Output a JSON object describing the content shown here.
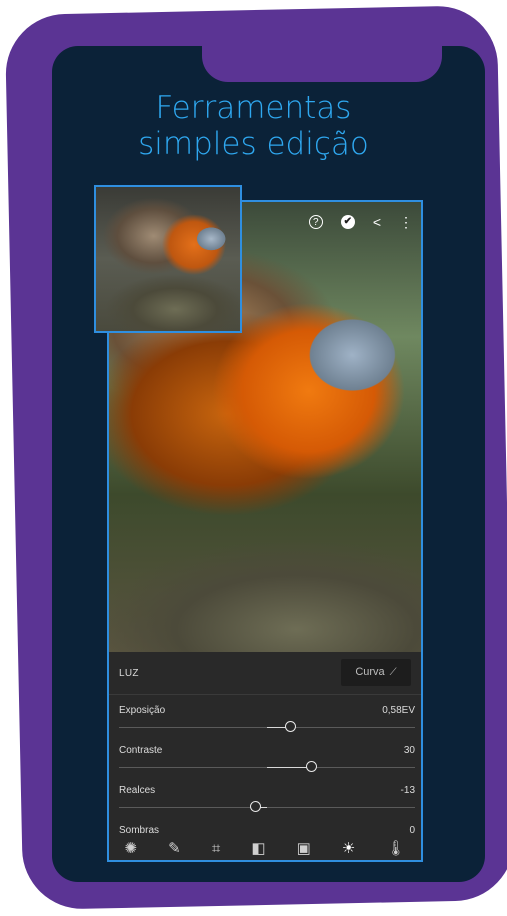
{
  "headline": {
    "line1": "Ferramentas",
    "line2": "simples edição"
  },
  "editor": {
    "top_icons": [
      {
        "name": "help-icon",
        "glyph": "?"
      },
      {
        "name": "check-icon",
        "glyph": "✔"
      },
      {
        "name": "share-icon",
        "glyph": "<"
      },
      {
        "name": "more-icon",
        "glyph": "⋮"
      }
    ],
    "panel": {
      "title": "LUZ",
      "curve_button": "Curva",
      "curve_icon_glyph": "⟋",
      "sliders": [
        {
          "label": "Exposição",
          "value": "0,58EV",
          "position": 0.58
        },
        {
          "label": "Contraste",
          "value": "30",
          "position": 0.65
        },
        {
          "label": "Realces",
          "value": "-13",
          "position": 0.46
        },
        {
          "label": "Sombras",
          "value": "0",
          "position": 0.5
        }
      ]
    },
    "toolbar": [
      {
        "name": "presets-icon",
        "glyph": "✺"
      },
      {
        "name": "healing-brush-icon",
        "glyph": "✎"
      },
      {
        "name": "crop-icon",
        "glyph": "⌗"
      },
      {
        "name": "selective-icon",
        "glyph": "◧"
      },
      {
        "name": "auto-icon",
        "glyph": "▣"
      },
      {
        "name": "light-icon",
        "glyph": "☀"
      },
      {
        "name": "temperature-icon",
        "glyph": "🌡"
      }
    ]
  },
  "colors": {
    "frame": "#5b3494",
    "screen": "#0b2238",
    "accent": "#2fa8f0",
    "panel": "#292929"
  }
}
